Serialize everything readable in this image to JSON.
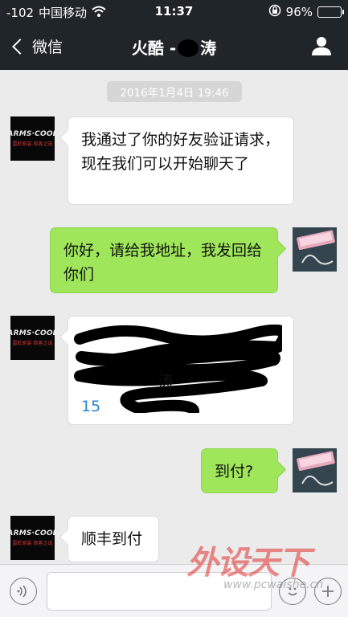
{
  "status_bar": {
    "signal": "-102",
    "carrier": "中国移动",
    "wifi_icon": "wifi-icon",
    "time": "11:37",
    "lock_icon": "orientation-lock-icon",
    "battery": "96%"
  },
  "nav": {
    "back_label": "微信",
    "title_prefix": "火酷 -",
    "title_suffix": "涛",
    "profile_icon": "person-icon"
  },
  "chat": {
    "timestamp": "2016年1月4日 19:46",
    "messages": [
      {
        "side": "in",
        "text": "我通过了你的好友验证请求，现在我们可以开始聊天了"
      },
      {
        "side": "out",
        "text": "你好，请给我地址，我发回给你们"
      },
      {
        "side": "in",
        "text_visible_fragment": "涛",
        "phone_fragment": "15"
      },
      {
        "side": "out",
        "text": "到付?"
      },
      {
        "side": "in",
        "text": "顺丰到付"
      }
    ],
    "contact_avatar": {
      "line1": "ARMS·COOL",
      "line2": "雷蛇原装 极客之选"
    }
  },
  "input_bar": {
    "voice_icon": "voice-icon",
    "emoji_icon": "emoji-icon",
    "plus_icon": "plus-icon"
  },
  "watermark": {
    "brand": "外设天下",
    "url": "www.pcwaishe.cn"
  },
  "colors": {
    "nav_bg": "#20252a",
    "chat_bg": "#ebebeb",
    "incoming_bubble": "#ffffff",
    "outgoing_bubble": "#9fe65a",
    "phone_link": "#2a85d0"
  }
}
